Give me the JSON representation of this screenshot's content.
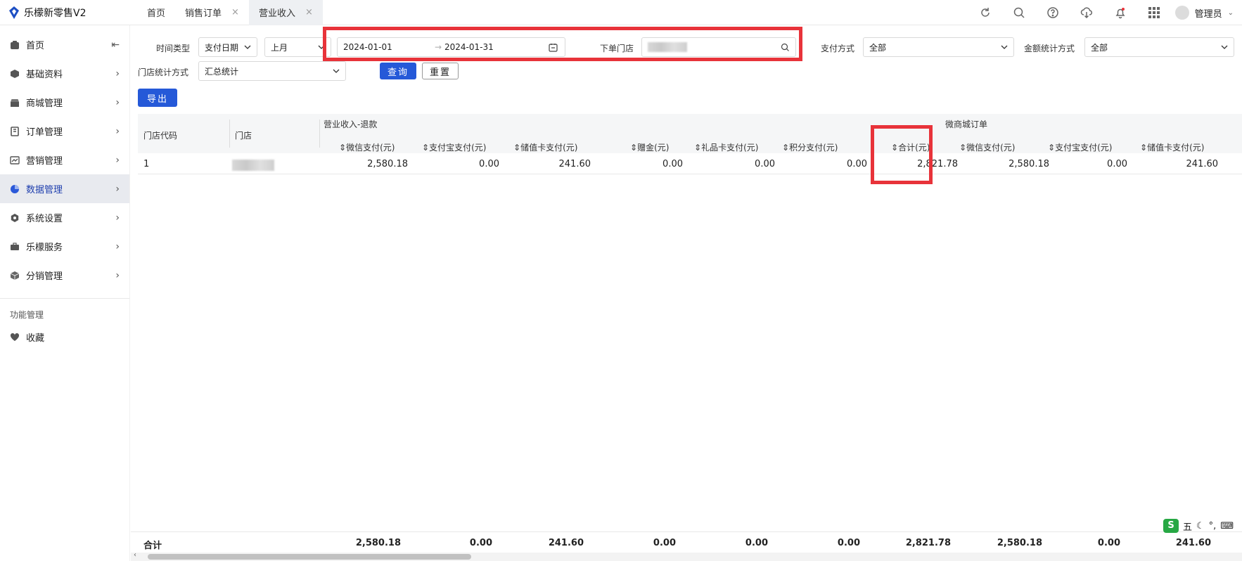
{
  "app": {
    "title": "乐檬新零售V2"
  },
  "tabs": [
    {
      "label": "首页"
    },
    {
      "label": "销售订单",
      "close": "×"
    },
    {
      "label": "营业收入",
      "close": "×"
    }
  ],
  "user": {
    "name": "管理员"
  },
  "sidebar": {
    "items": [
      {
        "label": "首页",
        "icon": "home-icon"
      },
      {
        "label": "基础资料",
        "icon": "cube-icon"
      },
      {
        "label": "商城管理",
        "icon": "shop-icon"
      },
      {
        "label": "订单管理",
        "icon": "order-icon"
      },
      {
        "label": "营销管理",
        "icon": "chart-line-icon"
      },
      {
        "label": "数据管理",
        "icon": "pie-chart-icon"
      },
      {
        "label": "系统设置",
        "icon": "hexagon-icon"
      },
      {
        "label": "乐檬服务",
        "icon": "briefcase-icon"
      },
      {
        "label": "分销管理",
        "icon": "box-icon"
      }
    ],
    "section_label": "功能管理",
    "favorites_label": "收藏"
  },
  "filters": {
    "time_type_label": "时间类型",
    "time_type_value": "支付日期",
    "period_value": "上月",
    "date_start": "2024-01-01",
    "date_sep": "→",
    "date_end": "2024-01-31",
    "store_label": "下单门店",
    "payment_label": "支付方式",
    "payment_value": "全部",
    "amount_stat_label": "金额统计方式",
    "amount_stat_value": "全部",
    "store_stat_label": "门店统计方式",
    "store_stat_value": "汇总统计",
    "query_button": "查询",
    "reset_button": "重置",
    "export_button": "导出"
  },
  "table": {
    "group_headers": [
      "营业收入-退款",
      "微商城订单"
    ],
    "columns": [
      "门店代码",
      "门店",
      "微信支付(元)",
      "支付宝支付(元)",
      "储值卡支付(元)",
      "赠金(元)",
      "礼品卡支付(元)",
      "积分支付(元)",
      "合计(元)",
      "微信支付(元)",
      "支付宝支付(元)",
      "储值卡支付(元)"
    ],
    "rows": [
      {
        "code": "1",
        "values": [
          "2,580.18",
          "0.00",
          "241.60",
          "0.00",
          "0.00",
          "0.00",
          "2,821.78",
          "2,580.18",
          "0.00",
          "241.60"
        ]
      }
    ],
    "footer": {
      "label": "合计",
      "values": [
        "2,580.18",
        "0.00",
        "241.60",
        "0.00",
        "0.00",
        "0.00",
        "2,821.78",
        "2,580.18",
        "0.00",
        "241.60"
      ]
    }
  },
  "ime": {
    "mode": "五"
  },
  "colors": {
    "accent": "#2559d8",
    "highlight": "#e8333a",
    "active_menu_bg": "#e8eaef"
  }
}
